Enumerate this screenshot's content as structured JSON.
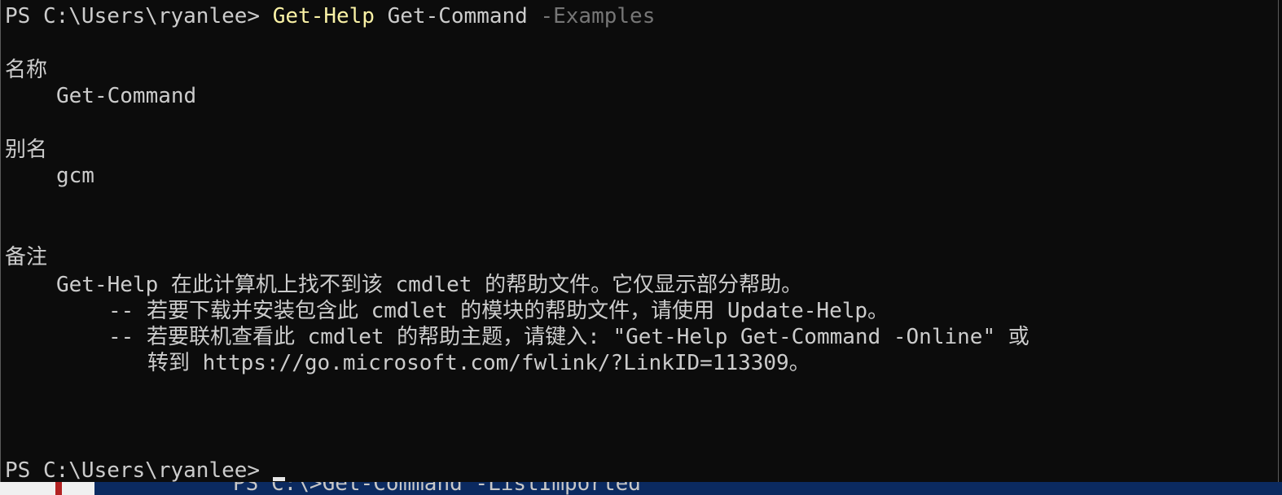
{
  "terminal": {
    "prompt1": {
      "prompt": "PS C:\\Users\\ryanlee> ",
      "command": "Get-Help",
      "arg": " Get-Command ",
      "param": "-Examples"
    },
    "sections": {
      "name_header": "名称",
      "name_value": "Get-Command",
      "alias_header": "别名",
      "alias_value": "gcm",
      "remarks_header": "备注",
      "remarks_line1": "Get-Help 在此计算机上找不到该 cmdlet 的帮助文件。它仅显示部分帮助。",
      "remarks_line2": "-- 若要下载并安装包含此 cmdlet 的模块的帮助文件，请使用 Update-Help。",
      "remarks_line3": "-- 若要联机查看此 cmdlet 的帮助主题，请键入: \"Get-Help Get-Command -Online\" 或",
      "remarks_line4": "转到 https://go.microsoft.com/fwlink/?LinkID=113309。"
    },
    "prompt2": {
      "prompt": "PS C:\\Users\\ryanlee> "
    }
  },
  "background_window": {
    "text": "PS C:\\>Get-Command -ListImported"
  },
  "colors": {
    "background": "#0c0c0c",
    "text": "#cccccc",
    "command": "#f9f1a5",
    "parameter": "#767676"
  }
}
